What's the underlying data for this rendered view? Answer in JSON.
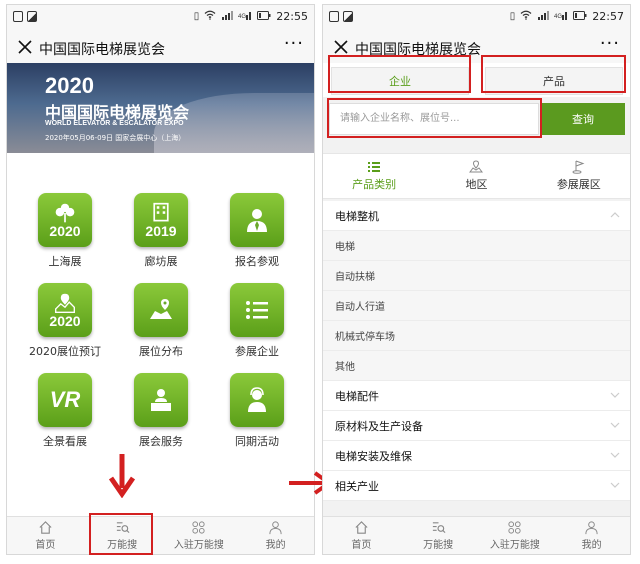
{
  "app": {
    "title": "中国国际电梯展览会",
    "more": "···"
  },
  "status": {
    "left_phone_time": "22:55",
    "right_phone_time": "22:57"
  },
  "banner": {
    "year": "2020",
    "title": "中国国际电梯展览会",
    "subtitle_en": "WORLD ELEVATOR & ESCALATOR EXPO",
    "date_venue": "2020年05月06-09日   国家会展中心（上海）"
  },
  "grid": {
    "items": [
      {
        "label": "上海展",
        "badge": "2020",
        "icon": "clover-icon"
      },
      {
        "label": "廊坊展",
        "badge": "2019",
        "icon": "building-icon"
      },
      {
        "label": "报名参观",
        "badge": "",
        "icon": "person-tie-icon"
      },
      {
        "label": "2020展位预订",
        "badge": "2020",
        "icon": "map-pin-icon"
      },
      {
        "label": "展位分布",
        "badge": "",
        "icon": "location-map-icon"
      },
      {
        "label": "参展企业",
        "badge": "",
        "icon": "list-icon"
      },
      {
        "label": "全景看展",
        "badge": "VR",
        "icon": "vr-icon"
      },
      {
        "label": "展会服务",
        "badge": "",
        "icon": "service-desk-icon"
      },
      {
        "label": "同期活动",
        "badge": "",
        "icon": "headset-person-icon"
      }
    ]
  },
  "tabbar": {
    "items": [
      {
        "label": "首页",
        "icon": "home-icon"
      },
      {
        "label": "万能搜",
        "icon": "search-list-icon"
      },
      {
        "label": "入驻万能搜",
        "icon": "grid-apps-icon"
      },
      {
        "label": "我的",
        "icon": "user-icon"
      }
    ]
  },
  "search": {
    "tab_enterprise": "企业",
    "tab_product": "产品",
    "placeholder": "请输入企业名称、展位号...",
    "button": "查询"
  },
  "filters": [
    {
      "label": "产品类别",
      "icon": "list-icon",
      "active": true
    },
    {
      "label": "地区",
      "icon": "map-icon",
      "active": false
    },
    {
      "label": "参展展区",
      "icon": "flag-icon",
      "active": false
    }
  ],
  "categories": [
    {
      "label": "电梯整机",
      "type": "header",
      "expanded": true
    },
    {
      "label": "电梯",
      "type": "sub"
    },
    {
      "label": "自动扶梯",
      "type": "sub"
    },
    {
      "label": "自动人行道",
      "type": "sub"
    },
    {
      "label": "机械式停车场",
      "type": "sub"
    },
    {
      "label": "其他",
      "type": "sub"
    },
    {
      "label": "电梯配件",
      "type": "header",
      "expanded": false
    },
    {
      "label": "原材料及生产设备",
      "type": "header",
      "expanded": false
    },
    {
      "label": "电梯安装及维保",
      "type": "header",
      "expanded": false
    },
    {
      "label": "相关产业",
      "type": "header",
      "expanded": false
    }
  ],
  "colors": {
    "accent_green": "#5a9e1a",
    "tile_green": "#6fb02a",
    "annotation_red": "#d32020"
  }
}
